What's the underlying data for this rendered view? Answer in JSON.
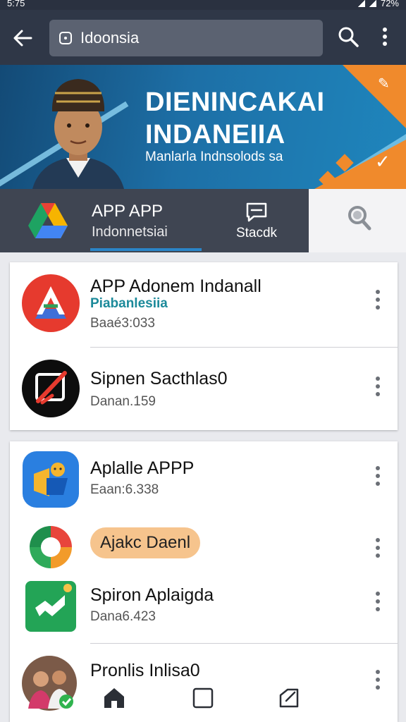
{
  "status_bar": {
    "time": "5:75",
    "battery": "72%"
  },
  "toolbar": {
    "search_value": "Idoonsia",
    "icons": [
      "back-arrow-icon",
      "search-icon",
      "more-vert-icon"
    ]
  },
  "banner": {
    "title_line1": "DIENINCAKAI",
    "title_line2": "INDANEIIA",
    "subtitle": "Manlarla Indnsolods sa"
  },
  "app_header": {
    "name": "APP APP",
    "subtitle": "Indonnetsiai",
    "action_label": "Stacdk"
  },
  "list_group1": [
    {
      "title": "APP Adonem Indanall",
      "tag": "Piabanlesiia",
      "meta": "Baaé3:033"
    },
    {
      "title": "Sipnen Sacthlas0",
      "meta": "Danan.159"
    }
  ],
  "list_group2": [
    {
      "title": "Aplalle APPP",
      "meta": "Eaan:6.338"
    },
    {
      "pill": "Ajakc Daenl"
    },
    {
      "title": "Spiron Aplaigda",
      "meta": "Dana6.423"
    },
    {
      "title": "Pronlis Inlisa0"
    }
  ],
  "colors": {
    "toolbar": "#2f3747",
    "app_header": "#3f4552",
    "accent_blue": "#2a85c8",
    "banner_orange": "#f08a2c",
    "tag_teal": "#1c8a9a",
    "pill": "#f6c48d"
  },
  "bottom_nav": [
    "home-icon",
    "square-icon",
    "edit-icon"
  ]
}
